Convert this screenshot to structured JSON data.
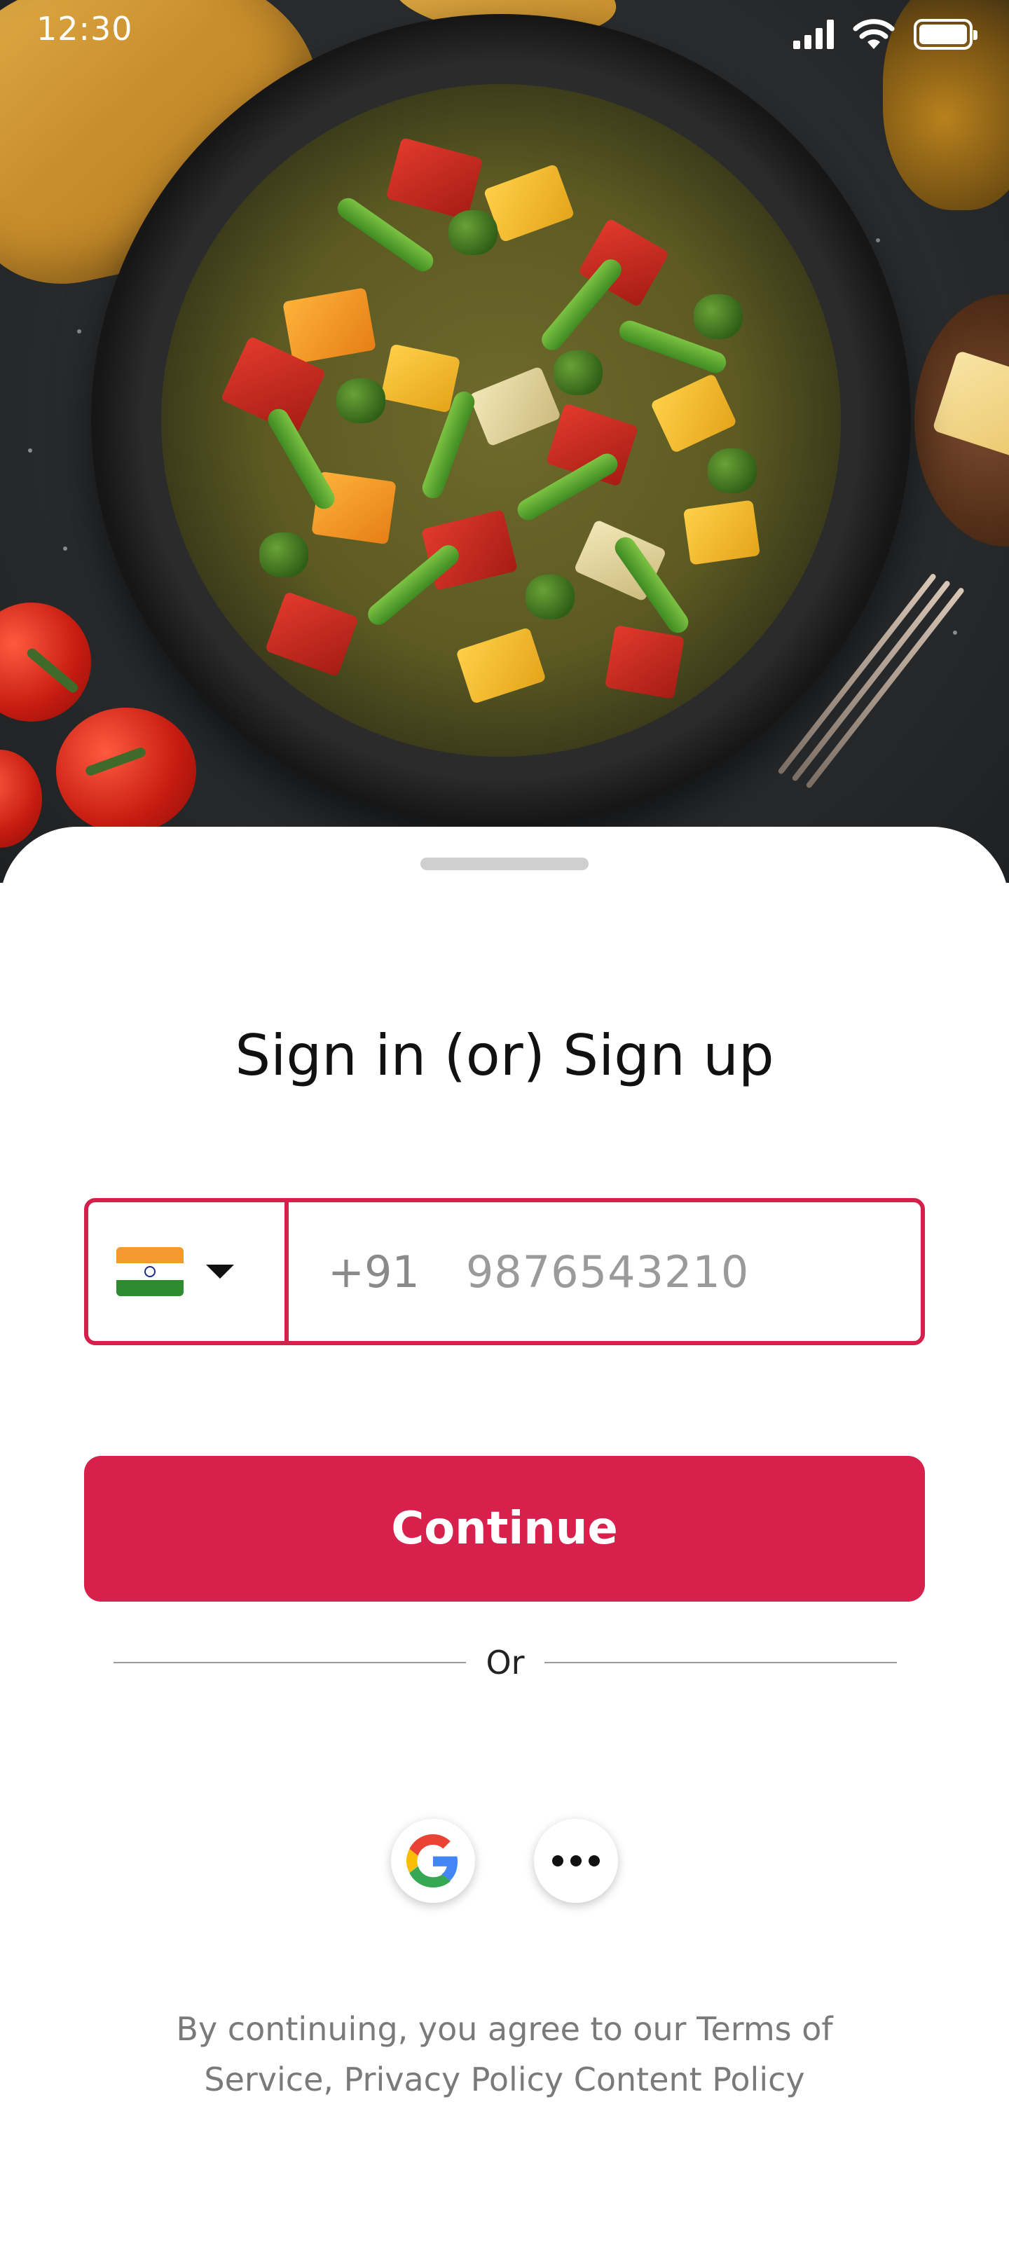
{
  "status_bar": {
    "time": "12:30",
    "icons": [
      "cellular-signal-icon",
      "wifi-icon",
      "battery-icon"
    ]
  },
  "hero": {
    "image": "food-image"
  },
  "sheet": {
    "title": "Sign in (or) Sign up",
    "phone": {
      "country_flag": "india-flag-icon",
      "dial_code": "+91",
      "placeholder": "9876543210",
      "value": ""
    },
    "continue_label": "Continue",
    "divider_label": "Or",
    "social": [
      "google-icon",
      "more-options-icon"
    ],
    "legal_text": "By continuing, you agree to our Terms of Service, Privacy Policy Content Policy"
  },
  "colors": {
    "accent": "#d7204c",
    "text_primary": "#111111",
    "text_muted": "#7a7a7a"
  }
}
